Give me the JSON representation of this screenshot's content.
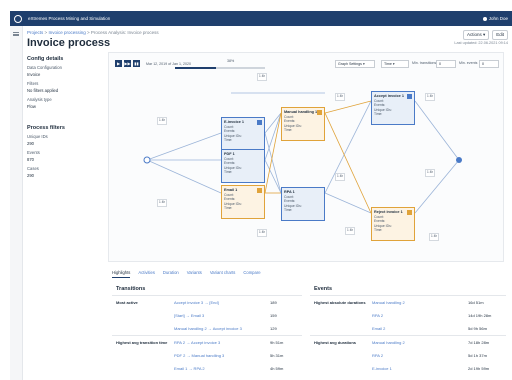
{
  "app": {
    "title": "eXtremes Process Mining and Simulation",
    "user": "John Doe"
  },
  "breadcrumb": {
    "part1": "Projects",
    "sep1": ">",
    "part2": "Invoice processing",
    "sep2": ">",
    "part3": "Process Analysis: Invoice process"
  },
  "page": {
    "title": "Invoice process",
    "updated": "Last updated: 22.06.2021 09:14"
  },
  "header_actions": {
    "actions": "Actions ▾",
    "edit": "Edit"
  },
  "sidebar": {
    "config_title": "Config details",
    "data_config_label": "Data Configuration",
    "data_config_value": "Invoice",
    "filters_label": "Filters",
    "filters_value": "No filters applied",
    "analysis_label": "Analysis type",
    "analysis_value": "Flow",
    "process_filters_title": "Process filters",
    "unique_ids_label": "Unique IDs",
    "unique_ids_value": "290",
    "events_label": "Events",
    "events_value": "870",
    "cases_label": "Cases",
    "cases_value": "290"
  },
  "map_controls": {
    "date_range": "Mar 12, 2019 of Jan 1, 2020",
    "percent": "38%",
    "percent_value": 0.45,
    "graph_settings": "Graph Settings ▾",
    "time": "Time ▾",
    "min_transitions": "Min. transitions",
    "min_transitions_value": "0",
    "min_events": "Min. events",
    "min_events_value": "0"
  },
  "nodes": [
    {
      "title": "E-invoice 1",
      "l1": "Count:",
      "l2": "Events:",
      "l3": "Unique IDs:",
      "l4": "Time:",
      "color": "blue"
    },
    {
      "title": "PDF 1",
      "l1": "Count:",
      "l2": "Events:",
      "l3": "Unique IDs:",
      "l4": "Time:",
      "color": "blue"
    },
    {
      "title": "Email 1",
      "l1": "Count:",
      "l2": "Events:",
      "l3": "Unique IDs:",
      "l4": "Time:",
      "color": "orange"
    },
    {
      "title": "Manual handling 1",
      "l1": "Count:",
      "l2": "Events:",
      "l3": "Unique IDs:",
      "l4": "Time:",
      "color": "orange"
    },
    {
      "title": "RPA 1",
      "l1": "Count:",
      "l2": "Events:",
      "l3": "Unique IDs:",
      "l4": "Time:",
      "color": "blue"
    },
    {
      "title": "Accept invoice 1",
      "l1": "Count:",
      "l2": "Events:",
      "l3": "Unique IDs:",
      "l4": "Time:",
      "color": "blue"
    },
    {
      "title": "Reject invoice 1",
      "l1": "Count:",
      "l2": "Events:",
      "l3": "Unique IDs:",
      "l4": "Time:",
      "color": "orange"
    }
  ],
  "edge_tags": [
    "1 4h",
    "1 4h",
    "1 4h",
    "1 4h",
    "1 4h",
    "1 4h",
    "1 4h",
    "1 4h",
    "1 4h",
    "1 4h"
  ],
  "tabs": [
    "Highlights",
    "Activities",
    "Duration",
    "Variants",
    "Variant charts",
    "Compare"
  ],
  "transitions": {
    "title": "Transitions",
    "most_active_label": "Most active",
    "most_active": [
      {
        "path": "Accept invoice 3 → [End]",
        "count": "189"
      },
      {
        "path": "[Start] → Email 3",
        "count": "159"
      },
      {
        "path": "Manual handling 2 → Accept invoice 3",
        "count": "129"
      }
    ],
    "highest_avg_label": "Highest avg transition time",
    "highest_avg": [
      {
        "path": "RPA 2 → Accept invoice 3",
        "time": "9h 51m"
      },
      {
        "path": "PDF 2 → Manual handling 3",
        "time": "5h 31m"
      },
      {
        "path": "Email 1 → RPA 2",
        "time": "4h 59m"
      }
    ]
  },
  "events": {
    "title": "Events",
    "highest_abs_label": "Highest absolute durations",
    "highest_abs": [
      {
        "name": "Manual handling 2",
        "time": "16d 51m"
      },
      {
        "name": "RPA 2",
        "time": "14d 19h 28m"
      },
      {
        "name": "Email 2",
        "time": "5d 9h 56m"
      }
    ],
    "highest_avg_label": "Highest avg durations",
    "highest_avg": [
      {
        "name": "Manual handling 2",
        "time": "7d 18h 28m"
      },
      {
        "name": "RPA 2",
        "time": "5d 1h 37m"
      },
      {
        "name": "E-invoice 1",
        "time": "2d 19h 59m"
      }
    ]
  }
}
